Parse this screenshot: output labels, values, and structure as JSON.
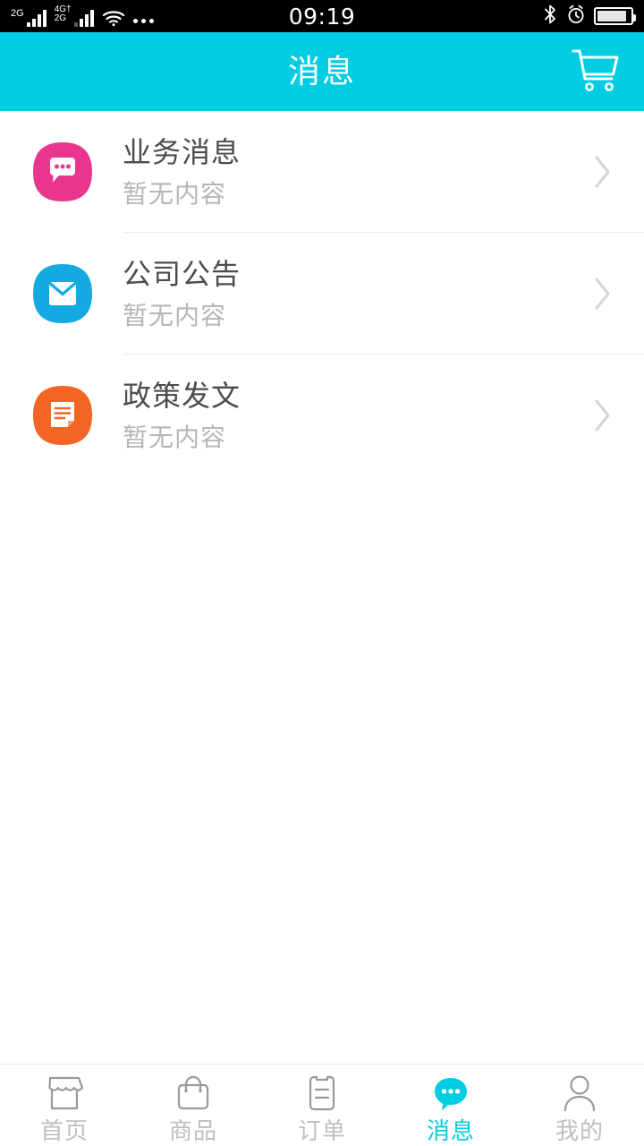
{
  "statusbar": {
    "sim1_label": "2G",
    "sim2_label_top": "4G†",
    "sim2_label_bottom": "2G",
    "wifi_icon": "wifi-icon",
    "more_icon": "more-dots-icon",
    "time": "09:19",
    "bluetooth_icon": "bluetooth-icon",
    "alarm_icon": "alarm-clock-icon",
    "battery_icon": "battery-icon"
  },
  "header": {
    "title": "消息",
    "cart_icon": "shopping-cart-icon",
    "background": "#00cde1"
  },
  "list": {
    "items": [
      {
        "icon": "chat-bubble-icon",
        "icon_color": "#e8368f",
        "title": "业务消息",
        "subtitle": "暂无内容",
        "chevron": "chevron-right-icon"
      },
      {
        "icon": "envelope-icon",
        "icon_color": "#14a9e1",
        "title": "公司公告",
        "subtitle": "暂无内容",
        "chevron": "chevron-right-icon"
      },
      {
        "icon": "document-icon",
        "icon_color": "#f26522",
        "title": "政策发文",
        "subtitle": "暂无内容",
        "chevron": "chevron-right-icon"
      }
    ]
  },
  "tabbar": {
    "active_color": "#00cde1",
    "inactive_color": "#bfbfbf",
    "items": [
      {
        "label": "首页",
        "icon": "storefront-icon",
        "active": false
      },
      {
        "label": "商品",
        "icon": "shopping-bag-icon",
        "active": false
      },
      {
        "label": "订单",
        "icon": "clipboard-icon",
        "active": false
      },
      {
        "label": "消息",
        "icon": "chat-bubble-icon",
        "active": true
      },
      {
        "label": "我的",
        "icon": "person-icon",
        "active": false
      }
    ]
  }
}
